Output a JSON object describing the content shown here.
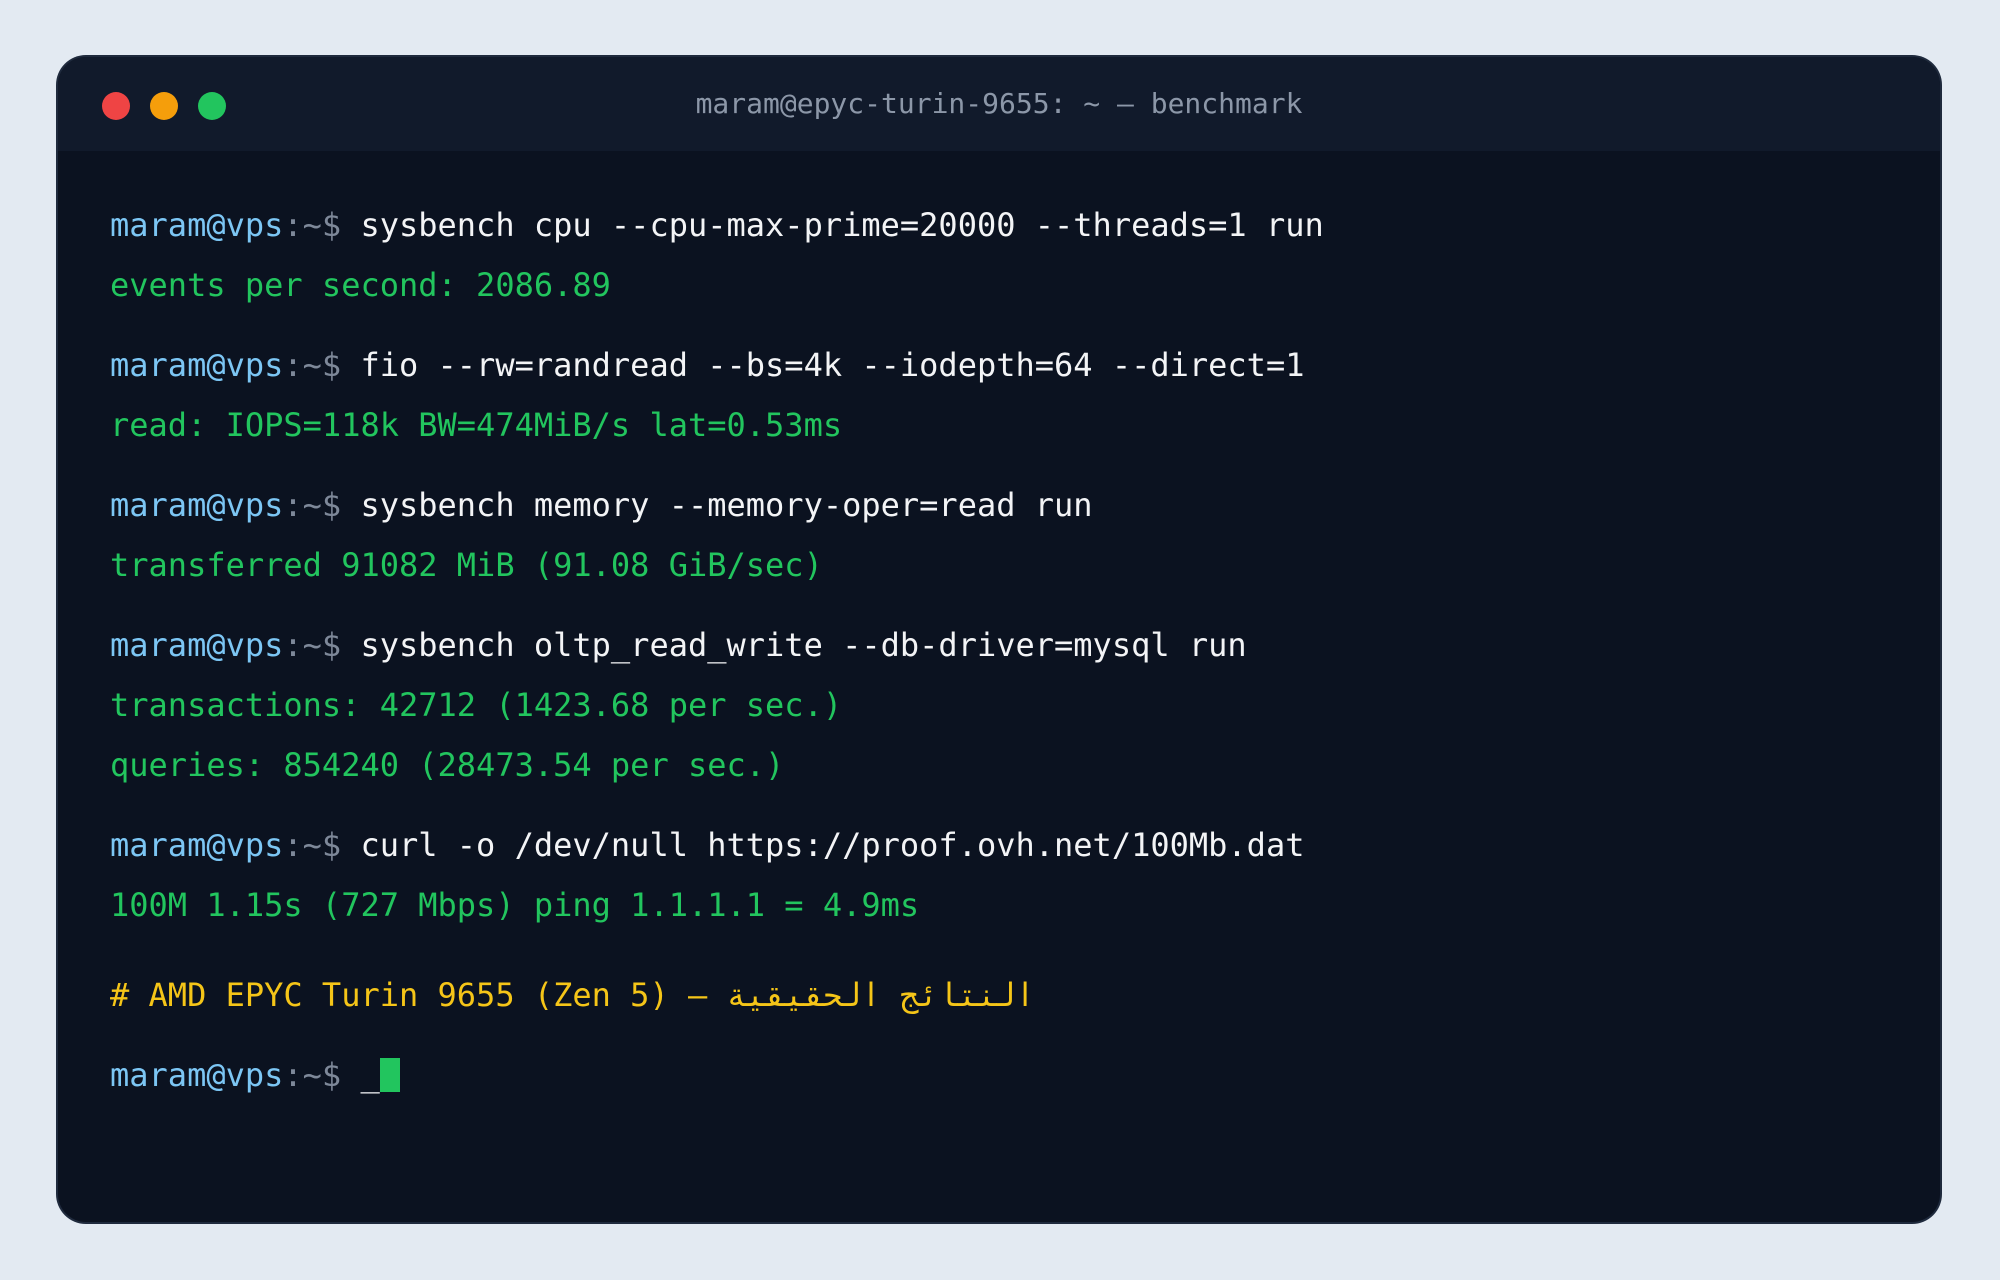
{
  "window": {
    "title": "maram@epyc-turin-9655: ~ — benchmark"
  },
  "prompt": {
    "user": "maram@vps",
    "path": ":~$",
    "cursor_char": "_"
  },
  "blocks": [
    {
      "command": "sysbench cpu --cpu-max-prime=20000 --threads=1 run",
      "output": [
        "events per second: 2086.89"
      ]
    },
    {
      "command": "fio --rw=randread --bs=4k --iodepth=64 --direct=1",
      "output": [
        "read: IOPS=118k BW=474MiB/s lat=0.53ms"
      ]
    },
    {
      "command": "sysbench memory --memory-oper=read run",
      "output": [
        "transferred 91082 MiB (91.08 GiB/sec)"
      ]
    },
    {
      "command": "sysbench oltp_read_write --db-driver=mysql run",
      "output": [
        "transactions: 42712 (1423.68 per sec.)",
        "queries: 854240 (28473.54 per sec.)"
      ]
    },
    {
      "command": "curl -o /dev/null https://proof.ovh.net/100Mb.dat",
      "output": [
        "100M 1.15s (727 Mbps) ping 1.1.1.1 = 4.9ms"
      ]
    }
  ],
  "comment": "# AMD EPYC Turin 9655 (Zen 5) — النتائج الحقيقية",
  "colors": {
    "background": "#e3eaf2",
    "terminal": "#0b1220",
    "prompt_user": "#7cc6f4",
    "output": "#22c55e",
    "comment": "#f5c518"
  }
}
